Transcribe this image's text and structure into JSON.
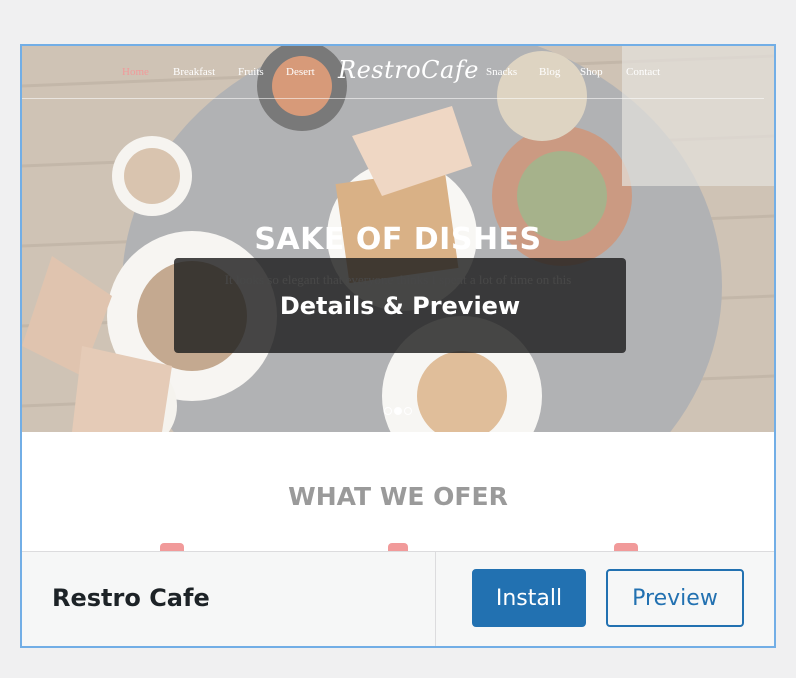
{
  "theme": {
    "name": "Restro Cafe",
    "overlay_label": "Details & Preview"
  },
  "site_preview": {
    "logo": "RestroCafe",
    "nav_left": [
      "Home",
      "Breakfast",
      "Fruits",
      "Desert"
    ],
    "nav_right": [
      "Snacks",
      "Blog",
      "Shop",
      "Contact"
    ],
    "hero_title": "SAKE OF DISHES",
    "hero_subtitle": "It looks so elegant that everyone thinks I spent a lot of time on this",
    "section_title": "WHAT WE OFER",
    "slider_active_index": 1
  },
  "actions": {
    "install_label": "Install",
    "preview_label": "Preview"
  },
  "colors": {
    "accent": "#2271b1",
    "selection_border": "#72aee6",
    "nav_active": "#f19a9a"
  }
}
